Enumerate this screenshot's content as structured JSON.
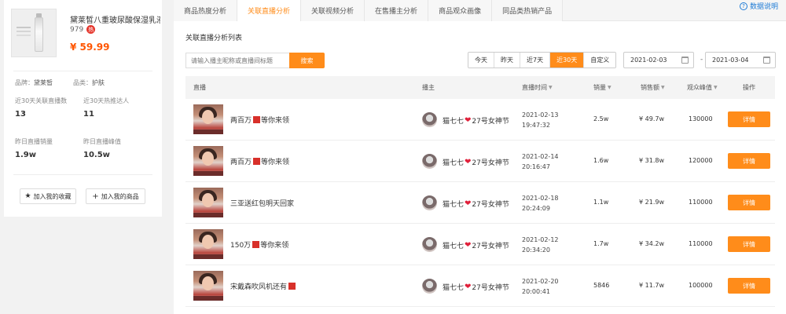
{
  "product": {
    "title": "黛莱皙八重玻尿酸保湿乳液A",
    "sub_number": "979",
    "hot_badge": "热",
    "price": "¥ 59.99",
    "brand_label": "品牌：",
    "brand_value": "黛莱皙",
    "category_label": "品类：",
    "category_value": "护肤",
    "stat1_label": "近30天关联直播数",
    "stat1_value": "13",
    "stat2_label": "近30天热推达人",
    "stat2_value": "11",
    "stat3_label": "昨日直播销量",
    "stat3_value": "1.9w",
    "stat4_label": "昨日直播峰值",
    "stat4_value": "10.5w",
    "fav_label": "加入我的收藏",
    "add_label": "加入我的商品"
  },
  "tabs": [
    "商品热度分析",
    "关联直播分析",
    "关联视频分析",
    "在售播主分析",
    "商品观众画像",
    "同品类热销产品"
  ],
  "active_tab_index": 1,
  "help_label": "数据说明",
  "section_title": "关联直播分析列表",
  "search": {
    "placeholder": "请输入播主昵称或直播间标题",
    "button": "搜索"
  },
  "ranges": [
    "今天",
    "昨天",
    "近7天",
    "近30天",
    "自定义"
  ],
  "active_range_index": 3,
  "date_from": "2021-02-03",
  "date_to": "2021-03-04",
  "date_sep": "-",
  "table": {
    "headers": {
      "live": "直播",
      "anchor": "播主",
      "time": "直播时间",
      "sales": "销量",
      "amount": "销售额",
      "viewers": "观众峰值",
      "action": "操作"
    },
    "rows": [
      {
        "title_a": "两百万",
        "title_b": "等你来领",
        "anchor_a": "猫七七",
        "anchor_b": "27号女神节",
        "date": "2021-02-13",
        "time": "19:47:32",
        "sales": "2.5w",
        "amount": "¥ 49.7w",
        "viewers": "130000",
        "action": "详情"
      },
      {
        "title_a": "两百万",
        "title_b": "等你来领",
        "anchor_a": "猫七七",
        "anchor_b": "27号女神节",
        "date": "2021-02-14",
        "time": "20:16:47",
        "sales": "1.6w",
        "amount": "¥ 31.8w",
        "viewers": "120000",
        "action": "详情"
      },
      {
        "title_a": "三亚送红包明天回家",
        "title_b": "",
        "anchor_a": "猫七七",
        "anchor_b": "27号女神节",
        "date": "2021-02-18",
        "time": "20:24:09",
        "sales": "1.1w",
        "amount": "¥ 21.9w",
        "viewers": "110000",
        "action": "详情"
      },
      {
        "title_a": "150万",
        "title_b": "等你来领",
        "anchor_a": "猫七七",
        "anchor_b": "27号女神节",
        "date": "2021-02-12",
        "time": "20:34:20",
        "sales": "1.7w",
        "amount": "¥ 34.2w",
        "viewers": "110000",
        "action": "详情"
      },
      {
        "title_a": "宋戴森吹风机还有",
        "title_b": "",
        "anchor_a": "猫七七",
        "anchor_b": "27号女神节",
        "date": "2021-02-20",
        "time": "20:00:41",
        "sales": "5846",
        "amount": "¥ 11.7w",
        "viewers": "100000",
        "action": "详情"
      }
    ]
  },
  "colors": {
    "accent": "#ff8c1a",
    "price": "#ff5500",
    "link": "#1e7bd6"
  }
}
